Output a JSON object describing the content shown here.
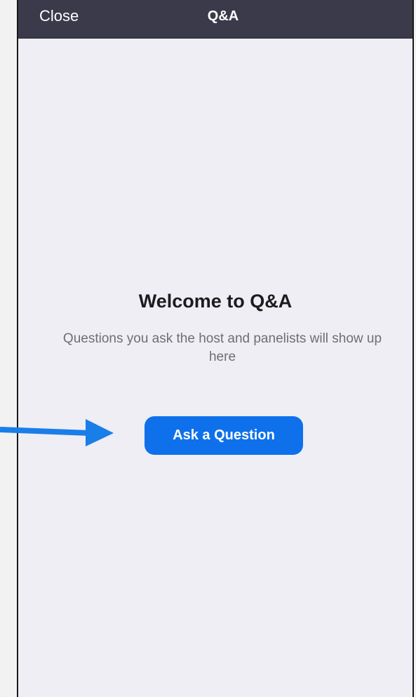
{
  "nav": {
    "close_label": "Close",
    "title": "Q&A"
  },
  "empty_state": {
    "title": "Welcome to Q&A",
    "subtitle": "Questions you ask the host and panelists will show up here",
    "button_label": "Ask a Question"
  },
  "colors": {
    "nav_background": "#3a3a4b",
    "page_background": "#efeef4",
    "button_accent": "#0e71eb",
    "annotation_arrow": "#1a7ee8"
  },
  "annotation": {
    "icon": "right-arrow-icon"
  }
}
